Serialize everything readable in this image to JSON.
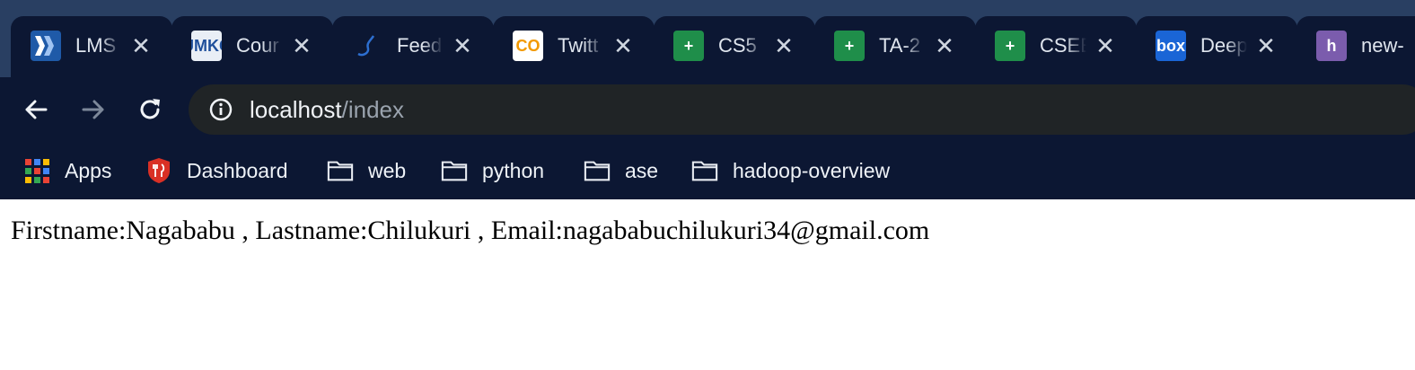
{
  "tabs": [
    {
      "title": "LMS",
      "icon": "lms-icon"
    },
    {
      "title": "Cour",
      "icon": "umkc-icon"
    },
    {
      "title": "Feed",
      "icon": "feedback-icon"
    },
    {
      "title": "Twitt",
      "icon": "colab-icon"
    },
    {
      "title": "CS5",
      "icon": "sheets-icon"
    },
    {
      "title": "TA-2",
      "icon": "sheets-icon"
    },
    {
      "title": "CSEE",
      "icon": "sheets-icon"
    },
    {
      "title": "Deep",
      "icon": "box-icon"
    },
    {
      "title": "new-",
      "icon": "heroku-icon"
    }
  ],
  "favicon_glyphs": {
    "umkc": "UMKC",
    "colab": "CO",
    "sheets": "+",
    "box": "box",
    "heroku": "h"
  },
  "close_glyph": "✕",
  "omnibox": {
    "host": "localhost",
    "path": "/index"
  },
  "bookmarks": {
    "apps": "Apps",
    "dashboard": "Dashboard",
    "web": "web",
    "python": "python",
    "ase": "ase",
    "hadoop": "hadoop-overview"
  },
  "content": {
    "text": "Firstname:Nagababu , Lastname:Chilukuri , Email:nagababuchilukuri34@gmail.com"
  },
  "colors": {
    "tabstrip": "#293f62",
    "active_bar": "#0c1733",
    "omnibox": "#202426",
    "sheets_green": "#1f8e4a",
    "dashboard_red": "#d93025"
  }
}
